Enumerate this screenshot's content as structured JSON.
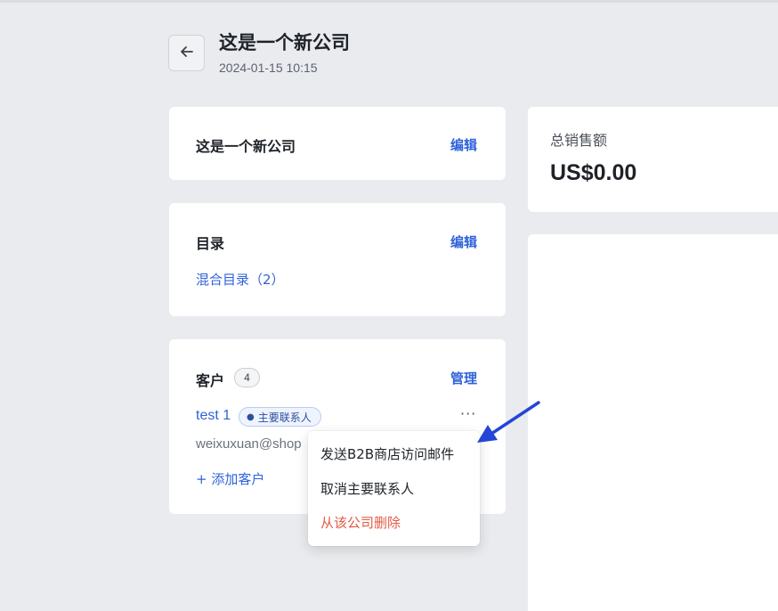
{
  "header": {
    "back_icon": "arrow-left-icon",
    "title": "这是一个新公司",
    "subtitle": "2024-01-15 10:15"
  },
  "company_card": {
    "name": "这是一个新公司",
    "edit_label": "编辑"
  },
  "catalog_card": {
    "title": "目录",
    "edit_label": "编辑",
    "catalog_link": "混合目录（2）"
  },
  "customers_card": {
    "title": "客户",
    "count": "4",
    "manage_label": "管理",
    "contact": {
      "name": "test 1",
      "badge": "主要联系人",
      "email": "weixuxuan@shop",
      "more_icon": "more-horizontal-icon"
    },
    "add_label": "+ 添加客户"
  },
  "sales_card": {
    "label": "总销售额",
    "value": "US$0.00"
  },
  "dropdown": {
    "items": [
      {
        "label": "发送B2B商店访问邮件"
      },
      {
        "label": "取消主要联系人"
      },
      {
        "label": "从该公司删除"
      }
    ]
  },
  "colors": {
    "link": "#2f63d9",
    "danger": "#e25b45",
    "annotation_arrow": "#2445d6",
    "background": "#e9ebee"
  }
}
